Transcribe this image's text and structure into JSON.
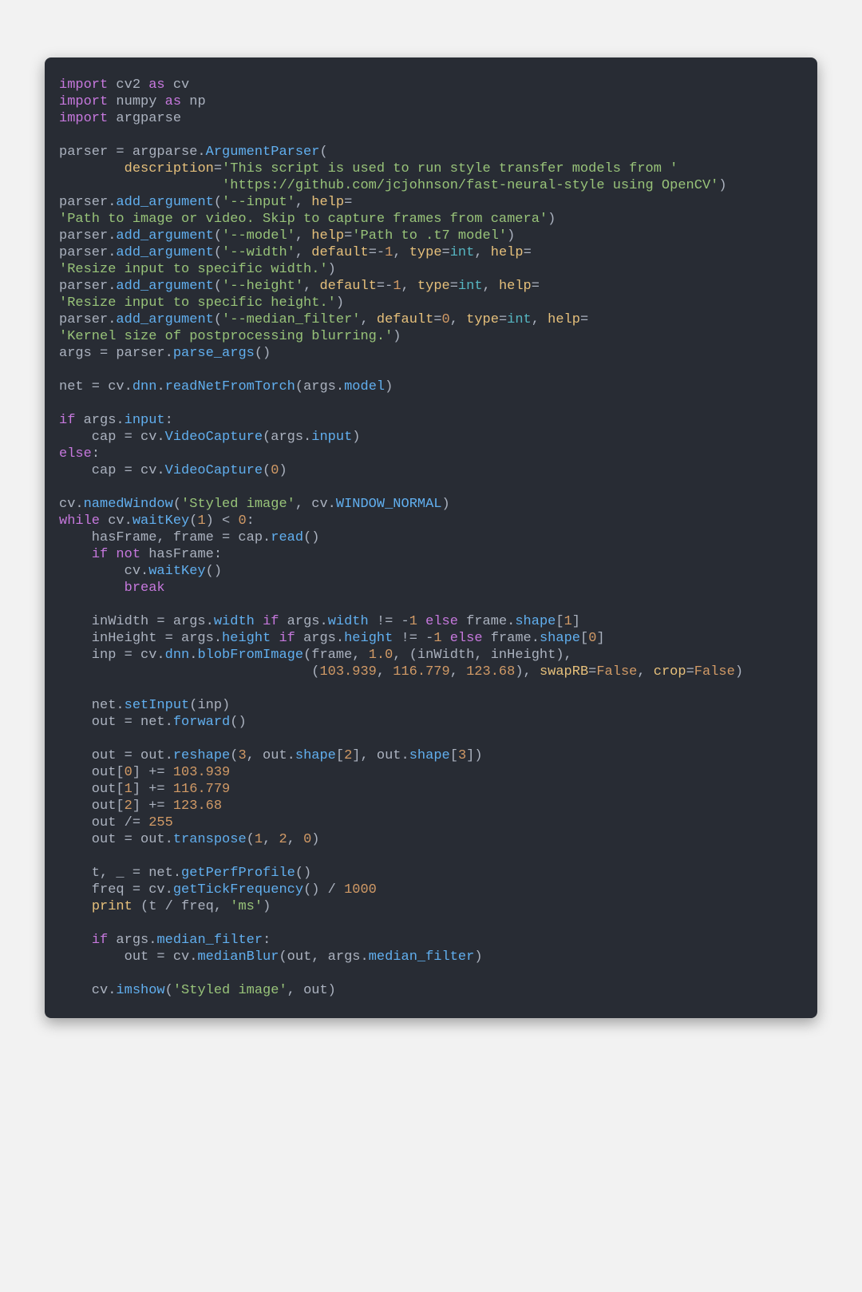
{
  "code": {
    "lines": [
      [
        [
          "kw",
          "import"
        ],
        [
          "op",
          " cv2 "
        ],
        [
          "kw",
          "as"
        ],
        [
          "op",
          " cv"
        ]
      ],
      [
        [
          "kw",
          "import"
        ],
        [
          "op",
          " numpy "
        ],
        [
          "kw",
          "as"
        ],
        [
          "op",
          " np"
        ]
      ],
      [
        [
          "kw",
          "import"
        ],
        [
          "op",
          " argparse"
        ]
      ],
      [
        [
          "op",
          ""
        ]
      ],
      [
        [
          "op",
          "parser = argparse."
        ],
        [
          "fn",
          "ArgumentParser"
        ],
        [
          "op",
          "("
        ]
      ],
      [
        [
          "op",
          "        "
        ],
        [
          "par",
          "description"
        ],
        [
          "op",
          "="
        ],
        [
          "str",
          "'This script is used to run style transfer models from '"
        ]
      ],
      [
        [
          "op",
          "                    "
        ],
        [
          "str",
          "'https://github.com/jcjohnson/fast-neural-style using OpenCV'"
        ],
        [
          "op",
          ")"
        ]
      ],
      [
        [
          "op",
          "parser."
        ],
        [
          "fn",
          "add_argument"
        ],
        [
          "op",
          "("
        ],
        [
          "str",
          "'--input'"
        ],
        [
          "op",
          ", "
        ],
        [
          "par",
          "help"
        ],
        [
          "op",
          "="
        ]
      ],
      [
        [
          "str",
          "'Path to image or video. Skip to capture frames from camera'"
        ],
        [
          "op",
          ")"
        ]
      ],
      [
        [
          "op",
          "parser."
        ],
        [
          "fn",
          "add_argument"
        ],
        [
          "op",
          "("
        ],
        [
          "str",
          "'--model'"
        ],
        [
          "op",
          ", "
        ],
        [
          "par",
          "help"
        ],
        [
          "op",
          "="
        ],
        [
          "str",
          "'Path to .t7 model'"
        ],
        [
          "op",
          ")"
        ]
      ],
      [
        [
          "op",
          "parser."
        ],
        [
          "fn",
          "add_argument"
        ],
        [
          "op",
          "("
        ],
        [
          "str",
          "'--width'"
        ],
        [
          "op",
          ", "
        ],
        [
          "par",
          "default"
        ],
        [
          "op",
          "=-"
        ],
        [
          "num",
          "1"
        ],
        [
          "op",
          ", "
        ],
        [
          "par",
          "type"
        ],
        [
          "op",
          "="
        ],
        [
          "typ",
          "int"
        ],
        [
          "op",
          ", "
        ],
        [
          "par",
          "help"
        ],
        [
          "op",
          "="
        ]
      ],
      [
        [
          "str",
          "'Resize input to specific width.'"
        ],
        [
          "op",
          ")"
        ]
      ],
      [
        [
          "op",
          "parser."
        ],
        [
          "fn",
          "add_argument"
        ],
        [
          "op",
          "("
        ],
        [
          "str",
          "'--height'"
        ],
        [
          "op",
          ", "
        ],
        [
          "par",
          "default"
        ],
        [
          "op",
          "=-"
        ],
        [
          "num",
          "1"
        ],
        [
          "op",
          ", "
        ],
        [
          "par",
          "type"
        ],
        [
          "op",
          "="
        ],
        [
          "typ",
          "int"
        ],
        [
          "op",
          ", "
        ],
        [
          "par",
          "help"
        ],
        [
          "op",
          "="
        ]
      ],
      [
        [
          "str",
          "'Resize input to specific height.'"
        ],
        [
          "op",
          ")"
        ]
      ],
      [
        [
          "op",
          "parser."
        ],
        [
          "fn",
          "add_argument"
        ],
        [
          "op",
          "("
        ],
        [
          "str",
          "'--median_filter'"
        ],
        [
          "op",
          ", "
        ],
        [
          "par",
          "default"
        ],
        [
          "op",
          "="
        ],
        [
          "num",
          "0"
        ],
        [
          "op",
          ", "
        ],
        [
          "par",
          "type"
        ],
        [
          "op",
          "="
        ],
        [
          "typ",
          "int"
        ],
        [
          "op",
          ", "
        ],
        [
          "par",
          "help"
        ],
        [
          "op",
          "="
        ]
      ],
      [
        [
          "str",
          "'Kernel size of postprocessing blurring.'"
        ],
        [
          "op",
          ")"
        ]
      ],
      [
        [
          "op",
          "args = parser."
        ],
        [
          "fn",
          "parse_args"
        ],
        [
          "op",
          "()"
        ]
      ],
      [
        [
          "op",
          ""
        ]
      ],
      [
        [
          "op",
          "net = cv."
        ],
        [
          "fn",
          "dnn"
        ],
        [
          "op",
          "."
        ],
        [
          "fn",
          "readNetFromTorch"
        ],
        [
          "op",
          "(args."
        ],
        [
          "fn",
          "model"
        ],
        [
          "op",
          ")"
        ]
      ],
      [
        [
          "op",
          ""
        ]
      ],
      [
        [
          "kw",
          "if"
        ],
        [
          "op",
          " args."
        ],
        [
          "fn",
          "input"
        ],
        [
          "op",
          ":"
        ]
      ],
      [
        [
          "op",
          "    cap = cv."
        ],
        [
          "fn",
          "VideoCapture"
        ],
        [
          "op",
          "(args."
        ],
        [
          "fn",
          "input"
        ],
        [
          "op",
          ")"
        ]
      ],
      [
        [
          "kw",
          "else"
        ],
        [
          "op",
          ":"
        ]
      ],
      [
        [
          "op",
          "    cap = cv."
        ],
        [
          "fn",
          "VideoCapture"
        ],
        [
          "op",
          "("
        ],
        [
          "num",
          "0"
        ],
        [
          "op",
          ")"
        ]
      ],
      [
        [
          "op",
          ""
        ]
      ],
      [
        [
          "op",
          "cv."
        ],
        [
          "fn",
          "namedWindow"
        ],
        [
          "op",
          "("
        ],
        [
          "str",
          "'Styled image'"
        ],
        [
          "op",
          ", cv."
        ],
        [
          "fn",
          "WINDOW_NORMAL"
        ],
        [
          "op",
          ")"
        ]
      ],
      [
        [
          "kw",
          "while"
        ],
        [
          "op",
          " cv."
        ],
        [
          "fn",
          "waitKey"
        ],
        [
          "op",
          "("
        ],
        [
          "num",
          "1"
        ],
        [
          "op",
          ") < "
        ],
        [
          "num",
          "0"
        ],
        [
          "op",
          ":"
        ]
      ],
      [
        [
          "op",
          "    hasFrame, frame = cap."
        ],
        [
          "fn",
          "read"
        ],
        [
          "op",
          "()"
        ]
      ],
      [
        [
          "op",
          "    "
        ],
        [
          "kw",
          "if"
        ],
        [
          "op",
          " "
        ],
        [
          "kw",
          "not"
        ],
        [
          "op",
          " hasFrame:"
        ]
      ],
      [
        [
          "op",
          "        cv."
        ],
        [
          "fn",
          "waitKey"
        ],
        [
          "op",
          "()"
        ]
      ],
      [
        [
          "op",
          "        "
        ],
        [
          "kw",
          "break"
        ]
      ],
      [
        [
          "op",
          ""
        ]
      ],
      [
        [
          "op",
          "    inWidth = args."
        ],
        [
          "fn",
          "width"
        ],
        [
          "op",
          " "
        ],
        [
          "kw",
          "if"
        ],
        [
          "op",
          " args."
        ],
        [
          "fn",
          "width"
        ],
        [
          "op",
          " != -"
        ],
        [
          "num",
          "1"
        ],
        [
          "op",
          " "
        ],
        [
          "kw",
          "else"
        ],
        [
          "op",
          " frame."
        ],
        [
          "fn",
          "shape"
        ],
        [
          "op",
          "["
        ],
        [
          "num",
          "1"
        ],
        [
          "op",
          "]"
        ]
      ],
      [
        [
          "op",
          "    inHeight = args."
        ],
        [
          "fn",
          "height"
        ],
        [
          "op",
          " "
        ],
        [
          "kw",
          "if"
        ],
        [
          "op",
          " args."
        ],
        [
          "fn",
          "height"
        ],
        [
          "op",
          " != -"
        ],
        [
          "num",
          "1"
        ],
        [
          "op",
          " "
        ],
        [
          "kw",
          "else"
        ],
        [
          "op",
          " frame."
        ],
        [
          "fn",
          "shape"
        ],
        [
          "op",
          "["
        ],
        [
          "num",
          "0"
        ],
        [
          "op",
          "]"
        ]
      ],
      [
        [
          "op",
          "    inp = cv."
        ],
        [
          "fn",
          "dnn"
        ],
        [
          "op",
          "."
        ],
        [
          "fn",
          "blobFromImage"
        ],
        [
          "op",
          "(frame, "
        ],
        [
          "num",
          "1.0"
        ],
        [
          "op",
          ", (inWidth, inHeight),"
        ]
      ],
      [
        [
          "op",
          "                               ("
        ],
        [
          "num",
          "103.939"
        ],
        [
          "op",
          ", "
        ],
        [
          "num",
          "116.779"
        ],
        [
          "op",
          ", "
        ],
        [
          "num",
          "123.68"
        ],
        [
          "op",
          "), "
        ],
        [
          "par",
          "swapRB"
        ],
        [
          "op",
          "="
        ],
        [
          "lit",
          "False"
        ],
        [
          "op",
          ", "
        ],
        [
          "par",
          "crop"
        ],
        [
          "op",
          "="
        ],
        [
          "lit",
          "False"
        ],
        [
          "op",
          ")"
        ]
      ],
      [
        [
          "op",
          ""
        ]
      ],
      [
        [
          "op",
          "    net."
        ],
        [
          "fn",
          "setInput"
        ],
        [
          "op",
          "(inp)"
        ]
      ],
      [
        [
          "op",
          "    out = net."
        ],
        [
          "fn",
          "forward"
        ],
        [
          "op",
          "()"
        ]
      ],
      [
        [
          "op",
          ""
        ]
      ],
      [
        [
          "op",
          "    out = out."
        ],
        [
          "fn",
          "reshape"
        ],
        [
          "op",
          "("
        ],
        [
          "num",
          "3"
        ],
        [
          "op",
          ", out."
        ],
        [
          "fn",
          "shape"
        ],
        [
          "op",
          "["
        ],
        [
          "num",
          "2"
        ],
        [
          "op",
          "], out."
        ],
        [
          "fn",
          "shape"
        ],
        [
          "op",
          "["
        ],
        [
          "num",
          "3"
        ],
        [
          "op",
          "])"
        ]
      ],
      [
        [
          "op",
          "    out["
        ],
        [
          "num",
          "0"
        ],
        [
          "op",
          "] += "
        ],
        [
          "num",
          "103.939"
        ]
      ],
      [
        [
          "op",
          "    out["
        ],
        [
          "num",
          "1"
        ],
        [
          "op",
          "] += "
        ],
        [
          "num",
          "116.779"
        ]
      ],
      [
        [
          "op",
          "    out["
        ],
        [
          "num",
          "2"
        ],
        [
          "op",
          "] += "
        ],
        [
          "num",
          "123.68"
        ]
      ],
      [
        [
          "op",
          "    out /= "
        ],
        [
          "num",
          "255"
        ]
      ],
      [
        [
          "op",
          "    out = out."
        ],
        [
          "fn",
          "transpose"
        ],
        [
          "op",
          "("
        ],
        [
          "num",
          "1"
        ],
        [
          "op",
          ", "
        ],
        [
          "num",
          "2"
        ],
        [
          "op",
          ", "
        ],
        [
          "num",
          "0"
        ],
        [
          "op",
          ")"
        ]
      ],
      [
        [
          "op",
          ""
        ]
      ],
      [
        [
          "op",
          "    t, _ = net."
        ],
        [
          "fn",
          "getPerfProfile"
        ],
        [
          "op",
          "()"
        ]
      ],
      [
        [
          "op",
          "    freq = cv."
        ],
        [
          "fn",
          "getTickFrequency"
        ],
        [
          "op",
          "() / "
        ],
        [
          "num",
          "1000"
        ]
      ],
      [
        [
          "op",
          "    "
        ],
        [
          "par",
          "print"
        ],
        [
          "op",
          " (t / freq, "
        ],
        [
          "str",
          "'ms'"
        ],
        [
          "op",
          ")"
        ]
      ],
      [
        [
          "op",
          ""
        ]
      ],
      [
        [
          "op",
          "    "
        ],
        [
          "kw",
          "if"
        ],
        [
          "op",
          " args."
        ],
        [
          "fn",
          "median_filter"
        ],
        [
          "op",
          ":"
        ]
      ],
      [
        [
          "op",
          "        out = cv."
        ],
        [
          "fn",
          "medianBlur"
        ],
        [
          "op",
          "(out, args."
        ],
        [
          "fn",
          "median_filter"
        ],
        [
          "op",
          ")"
        ]
      ],
      [
        [
          "op",
          ""
        ]
      ],
      [
        [
          "op",
          "    cv."
        ],
        [
          "fn",
          "imshow"
        ],
        [
          "op",
          "("
        ],
        [
          "str",
          "'Styled image'"
        ],
        [
          "op",
          ", out)"
        ]
      ]
    ]
  }
}
